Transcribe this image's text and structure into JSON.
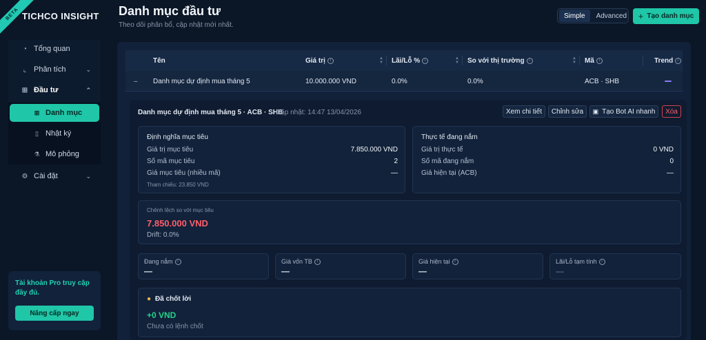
{
  "brand": {
    "name": "TICHCO INSIGHT",
    "badge": "BETA"
  },
  "sidebar": {
    "items": [
      {
        "label": "Tổng quan",
        "icon": "gauge-icon"
      },
      {
        "label": "Phân tích",
        "icon": "chart-icon"
      },
      {
        "label": "Đầu tư",
        "icon": "grid-icon"
      },
      {
        "label": "Cài đặt",
        "icon": "gear-icon"
      }
    ],
    "subitems": [
      {
        "label": "Danh mục",
        "icon": "grid-icon"
      },
      {
        "label": "Nhật ký",
        "icon": "book-icon"
      },
      {
        "label": "Mô phỏng",
        "icon": "flask-icon"
      }
    ],
    "pro_text": "Tài khoản Pro truy cập đầy đủ.",
    "upgrade_label": "Nâng cấp ngay"
  },
  "header": {
    "title": "Danh mục đầu tư",
    "subtitle": "Theo dõi phân bổ, cập nhật mới nhất.",
    "mode_simple": "Simple",
    "mode_advanced": "Advanced",
    "create_label": "Tạo danh mục",
    "create_icon": "+"
  },
  "table": {
    "columns": [
      "Tên",
      "Giá trị",
      "Lãi/Lỗ %",
      "So với thị trường",
      "Mã",
      "Trend"
    ],
    "row": {
      "toggle": "–",
      "name": "Danh mục dự định mua tháng 5",
      "value": "10.000.000 VND",
      "pl": "0.0%",
      "vs_market": "0.0%",
      "codes": "ACB · SHB"
    }
  },
  "detail": {
    "title": "Danh mục dự định mua tháng 5 · ACB · SHB",
    "updated": "Cập nhật: 14:47 13/04/2026",
    "buttons": {
      "view": "Xem chi tiết",
      "edit": "Chỉnh sửa",
      "bot": "Tạo Bot AI nhanh",
      "delete": "Xóa"
    },
    "target": {
      "title": "Định nghĩa mục tiêu",
      "rows": [
        {
          "k": "Giá trị mục tiêu",
          "v": "7.850.000 VND"
        },
        {
          "k": "Số mã mục tiêu",
          "v": "2"
        },
        {
          "k": "Giá mục tiêu (nhiều mã)",
          "v": "—"
        }
      ],
      "ref": "Tham chiếu: 23.850 VND"
    },
    "actual": {
      "title": "Thực tế đang nắm",
      "rows": [
        {
          "k": "Giá trị thực tế",
          "v": "0 VND"
        },
        {
          "k": "Số mã đang nắm",
          "v": "0"
        },
        {
          "k": "Giá hiện tại (ACB)",
          "v": "—"
        }
      ]
    },
    "deviation": {
      "label": "Chênh lệch so với mục tiêu",
      "value": "7.850.000 VND",
      "drift": "Drift: 0.0%"
    },
    "stats": [
      {
        "label": "Đang nắm",
        "value": "—"
      },
      {
        "label": "Giá vốn TB",
        "value": "—"
      },
      {
        "label": "Giá hiện tại",
        "value": "—"
      },
      {
        "label": "Lãi/Lỗ tạm tính",
        "value": "—"
      }
    ],
    "realized": {
      "icon": "money-bag-icon",
      "title": "Đã chốt lời",
      "value": "+0 VND",
      "note": "Chưa có lệnh chốt"
    }
  },
  "colors": {
    "accent": "#20c6a8",
    "negative": "#ff5f6d",
    "positive": "#24d28a",
    "trend": "#8b7cf6"
  }
}
